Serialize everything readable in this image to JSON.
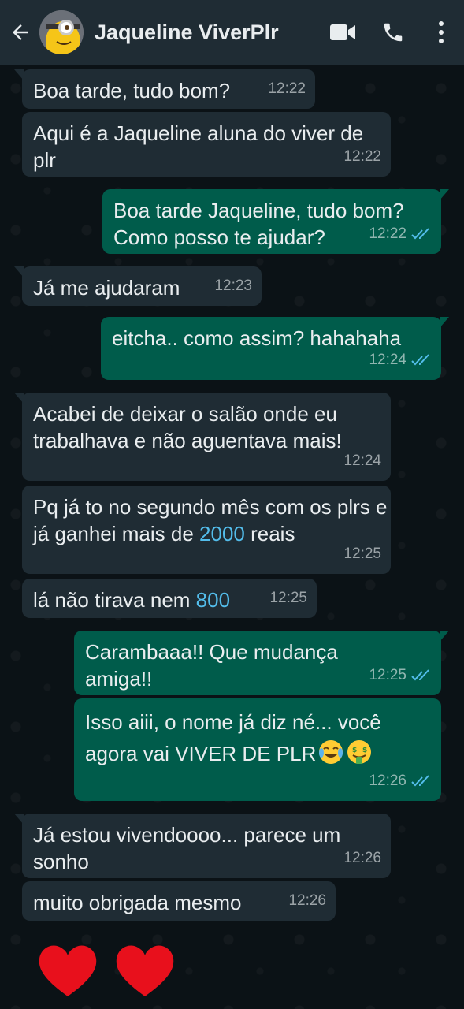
{
  "header": {
    "contact_name": "Jaqueline ViverPlr",
    "icons": [
      "back-arrow-icon",
      "avatar",
      "video-call-icon",
      "voice-call-icon",
      "more-options-icon"
    ]
  },
  "colors": {
    "header_bg": "#1f2c34",
    "incoming_bubble": "#1f2c34",
    "outgoing_bubble": "#005c4b",
    "read_ticks": "#53bdeb",
    "chat_bg": "#0b1216"
  },
  "messages": [
    {
      "dir": "in",
      "text": "Boa tarde, tudo bom?",
      "time": "12:22"
    },
    {
      "dir": "in",
      "text": "Aqui é a Jaqueline aluna do viver de plr",
      "time": "12:22"
    },
    {
      "dir": "out",
      "text": "Boa tarde Jaqueline, tudo bom? Como posso te ajudar?",
      "time": "12:22",
      "status": "read"
    },
    {
      "dir": "in",
      "text": "Já me ajudaram",
      "time": "12:23"
    },
    {
      "dir": "out",
      "text": "eitcha.. como assim? hahahaha",
      "time": "12:24",
      "status": "read"
    },
    {
      "dir": "in",
      "text": "Acabei de deixar o salão onde eu trabalhava e não aguentava mais!",
      "time": "12:24"
    },
    {
      "dir": "in",
      "text_parts": [
        "Pq já to no segundo mês com os plrs e já ganhei mais de ",
        "2000",
        " reais"
      ],
      "time": "12:25"
    },
    {
      "dir": "in",
      "text_parts": [
        "lá não tirava nem ",
        "800"
      ],
      "time": "12:25"
    },
    {
      "dir": "out",
      "text": "Carambaaa!! Que mudança amiga!!",
      "time": "12:25",
      "status": "read"
    },
    {
      "dir": "out",
      "text": "Isso aiii, o nome já diz né... você agora vai VIVER DE PLR",
      "emojis": [
        "tears-of-joy-emoji",
        "money-mouth-emoji"
      ],
      "time": "12:26",
      "status": "read"
    },
    {
      "dir": "in",
      "text": "Já estou vivendoooo... parece um sonho",
      "time": "12:26"
    },
    {
      "dir": "in",
      "text": "muito obrigada mesmo",
      "time": "12:26"
    }
  ],
  "decorations": [
    "heart-icon",
    "heart-icon"
  ]
}
